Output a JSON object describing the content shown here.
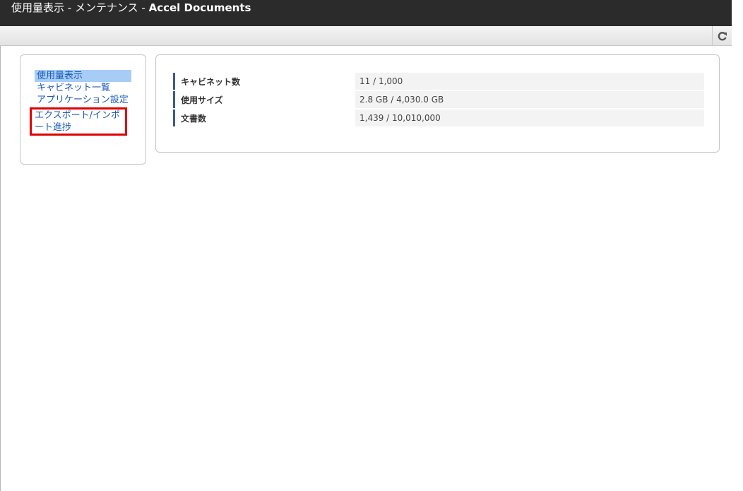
{
  "window": {
    "title_prefix": "使用量表示 - メンテナンス - ",
    "title_app": "Accel Documents"
  },
  "toolbar": {
    "refresh_icon": "refresh-icon"
  },
  "menu": {
    "items": [
      {
        "label": "使用量表示"
      },
      {
        "label": "キャビネット一覧"
      },
      {
        "label": "アプリケーション設定"
      },
      {
        "label": "エクスポート/インポート進捗"
      }
    ]
  },
  "usage": {
    "rows": [
      {
        "label": "キャビネット数",
        "value": "11 / 1,000"
      },
      {
        "label": "使用サイズ",
        "value": "2.8 GB / 4,030.0 GB"
      },
      {
        "label": "文書数",
        "value": "1,439 / 10,010,000"
      }
    ]
  },
  "colors": {
    "titlebar": "#2b2b2b",
    "link": "#1a5ab8",
    "selected": "#a7cdf6",
    "highlight_border": "#e00000",
    "label_bar": "#3a5a8c"
  }
}
